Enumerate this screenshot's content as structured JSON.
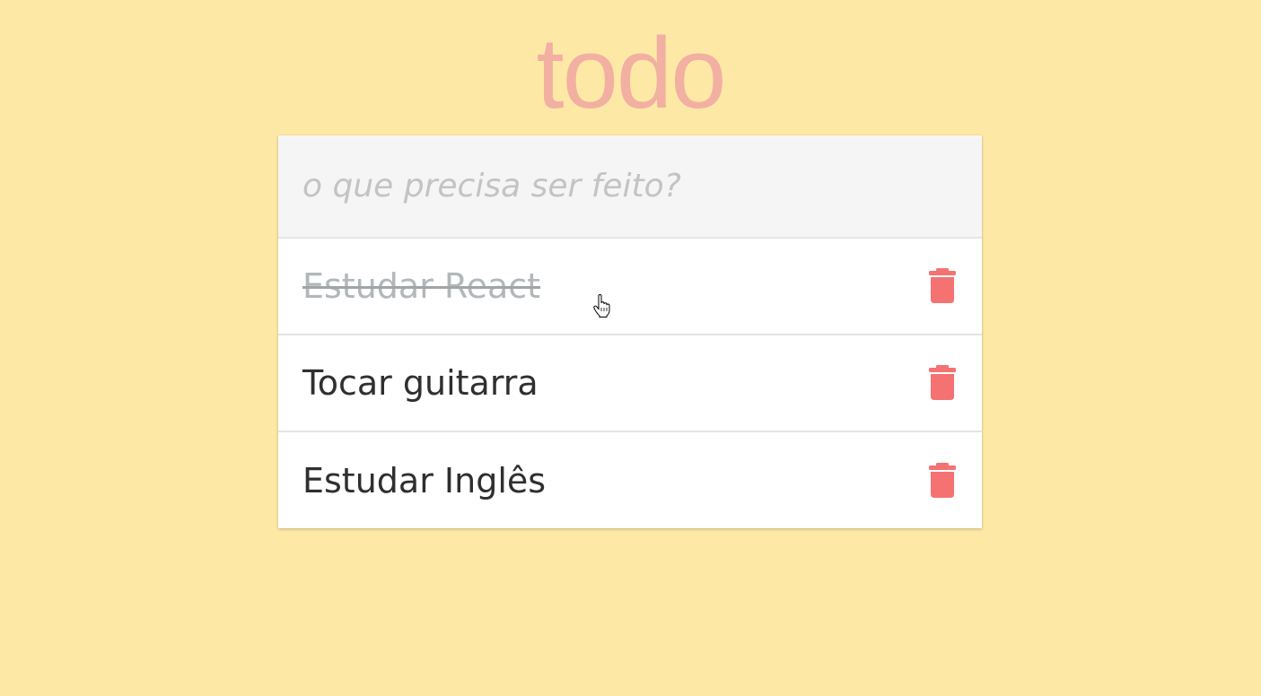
{
  "app": {
    "title": "todo"
  },
  "new_todo": {
    "placeholder": "o que precisa ser feito?",
    "value": ""
  },
  "todos": [
    {
      "text": "Estudar React",
      "completed": true,
      "delete_icon": "trash-icon"
    },
    {
      "text": "Tocar guitarra",
      "completed": false,
      "delete_icon": "trash-icon"
    },
    {
      "text": "Estudar Inglês",
      "completed": false,
      "delete_icon": "trash-icon"
    }
  ],
  "colors": {
    "background": "#fee8a5",
    "title": "#f2b0a2",
    "delete_icon": "#f47272",
    "completed_text": "#b3b7ba",
    "text": "#2f2f2f"
  },
  "cursor": {
    "icon": "hand-pointer-icon"
  }
}
